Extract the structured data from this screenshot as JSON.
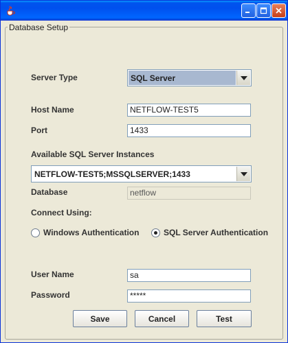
{
  "window": {
    "buttons": {
      "minimize": "_",
      "maximize": "□",
      "close": "✕"
    }
  },
  "group": {
    "title": "Database Setup"
  },
  "server_type": {
    "label": "Server Type",
    "value": "SQL Server"
  },
  "host_name": {
    "label": "Host Name",
    "value": "NETFLOW-TEST5"
  },
  "port": {
    "label": "Port",
    "value": "1433"
  },
  "instances": {
    "label": "Available SQL Server Instances",
    "value": "NETFLOW-TEST5;MSSQLSERVER;1433"
  },
  "database": {
    "label": "Database",
    "value": "netflow"
  },
  "connect_using": {
    "label": "Connect Using:",
    "options": [
      {
        "label": "Windows Authentication",
        "selected": false
      },
      {
        "label": "SQL Server Authentication",
        "selected": true
      }
    ]
  },
  "user_name": {
    "label": "User Name",
    "value": "sa"
  },
  "password": {
    "label": "Password",
    "value": "*****"
  },
  "actions": {
    "save": "Save",
    "cancel": "Cancel",
    "test": "Test"
  },
  "icons": {
    "app": "java-cup-icon",
    "dropdown": "chevron-down-icon"
  },
  "colors": {
    "titlebar": "#0053ee",
    "window_bg": "#ece9d8",
    "combo_selection": "#a8b8d0"
  }
}
